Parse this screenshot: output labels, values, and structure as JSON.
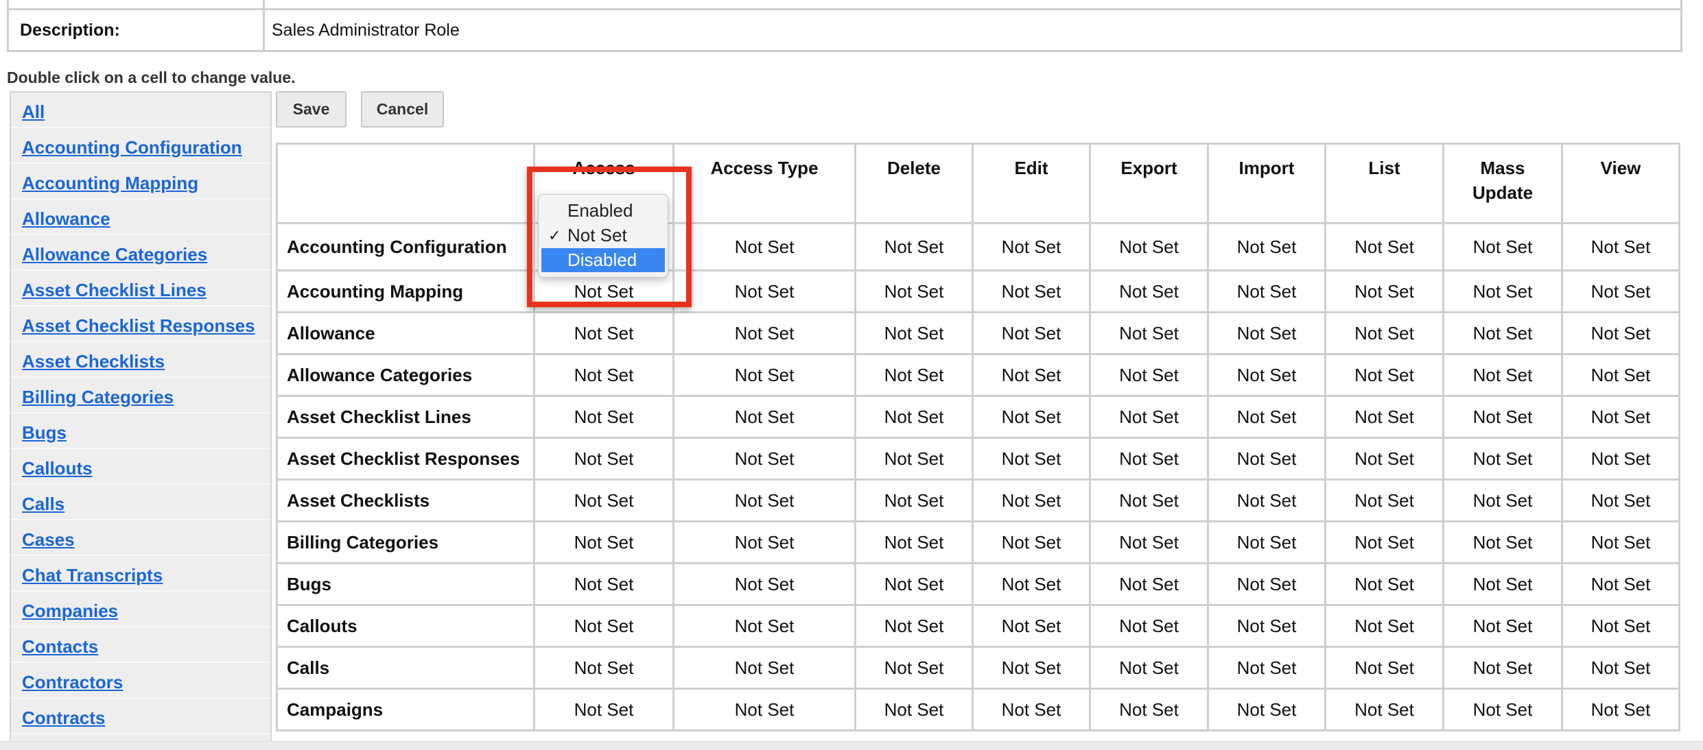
{
  "description": {
    "label": "Description:",
    "value": "Sales Administrator Role"
  },
  "hint": "Double click on a cell to change value.",
  "sidebar": {
    "items": [
      "All",
      "Accounting Configuration",
      "Accounting Mapping",
      "Allowance",
      "Allowance Categories",
      "Asset Checklist Lines",
      "Asset Checklist Responses",
      "Asset Checklists",
      "Billing Categories",
      "Bugs",
      "Callouts",
      "Calls",
      "Cases",
      "Chat Transcripts",
      "Companies",
      "Contacts",
      "Contractors",
      "Contracts"
    ]
  },
  "toolbar": {
    "save_label": "Save",
    "cancel_label": "Cancel"
  },
  "table": {
    "columns": [
      "",
      "Access",
      "Access Type",
      "Delete",
      "Edit",
      "Export",
      "Import",
      "List",
      "Mass Update",
      "View"
    ],
    "rows": [
      {
        "label": "Accounting Configuration",
        "values": [
          "",
          "Not Set",
          "Not Set",
          "Not Set",
          "Not Set",
          "Not Set",
          "Not Set",
          "Not Set",
          "Not Set"
        ]
      },
      {
        "label": "Accounting Mapping",
        "values": [
          "Not Set",
          "Not Set",
          "Not Set",
          "Not Set",
          "Not Set",
          "Not Set",
          "Not Set",
          "Not Set",
          "Not Set"
        ]
      },
      {
        "label": "Allowance",
        "values": [
          "Not Set",
          "Not Set",
          "Not Set",
          "Not Set",
          "Not Set",
          "Not Set",
          "Not Set",
          "Not Set",
          "Not Set"
        ]
      },
      {
        "label": "Allowance Categories",
        "values": [
          "Not Set",
          "Not Set",
          "Not Set",
          "Not Set",
          "Not Set",
          "Not Set",
          "Not Set",
          "Not Set",
          "Not Set"
        ]
      },
      {
        "label": "Asset Checklist Lines",
        "values": [
          "Not Set",
          "Not Set",
          "Not Set",
          "Not Set",
          "Not Set",
          "Not Set",
          "Not Set",
          "Not Set",
          "Not Set"
        ]
      },
      {
        "label": "Asset Checklist Responses",
        "values": [
          "Not Set",
          "Not Set",
          "Not Set",
          "Not Set",
          "Not Set",
          "Not Set",
          "Not Set",
          "Not Set",
          "Not Set"
        ]
      },
      {
        "label": "Asset Checklists",
        "values": [
          "Not Set",
          "Not Set",
          "Not Set",
          "Not Set",
          "Not Set",
          "Not Set",
          "Not Set",
          "Not Set",
          "Not Set"
        ]
      },
      {
        "label": "Billing Categories",
        "values": [
          "Not Set",
          "Not Set",
          "Not Set",
          "Not Set",
          "Not Set",
          "Not Set",
          "Not Set",
          "Not Set",
          "Not Set"
        ]
      },
      {
        "label": "Bugs",
        "values": [
          "Not Set",
          "Not Set",
          "Not Set",
          "Not Set",
          "Not Set",
          "Not Set",
          "Not Set",
          "Not Set",
          "Not Set"
        ]
      },
      {
        "label": "Callouts",
        "values": [
          "Not Set",
          "Not Set",
          "Not Set",
          "Not Set",
          "Not Set",
          "Not Set",
          "Not Set",
          "Not Set",
          "Not Set"
        ]
      },
      {
        "label": "Calls",
        "values": [
          "Not Set",
          "Not Set",
          "Not Set",
          "Not Set",
          "Not Set",
          "Not Set",
          "Not Set",
          "Not Set",
          "Not Set"
        ]
      },
      {
        "label": "Campaigns",
        "values": [
          "Not Set",
          "Not Set",
          "Not Set",
          "Not Set",
          "Not Set",
          "Not Set",
          "Not Set",
          "Not Set",
          "Not Set"
        ]
      }
    ]
  },
  "dropdown": {
    "options": [
      "Enabled",
      "Not Set",
      "Disabled"
    ],
    "checked": "Not Set",
    "highlighted": "Disabled",
    "check_glyph": "✓"
  },
  "colors": {
    "link": "#1a66d8",
    "highlight_box": "#e8321c",
    "selected_option": "#3a86f0"
  }
}
